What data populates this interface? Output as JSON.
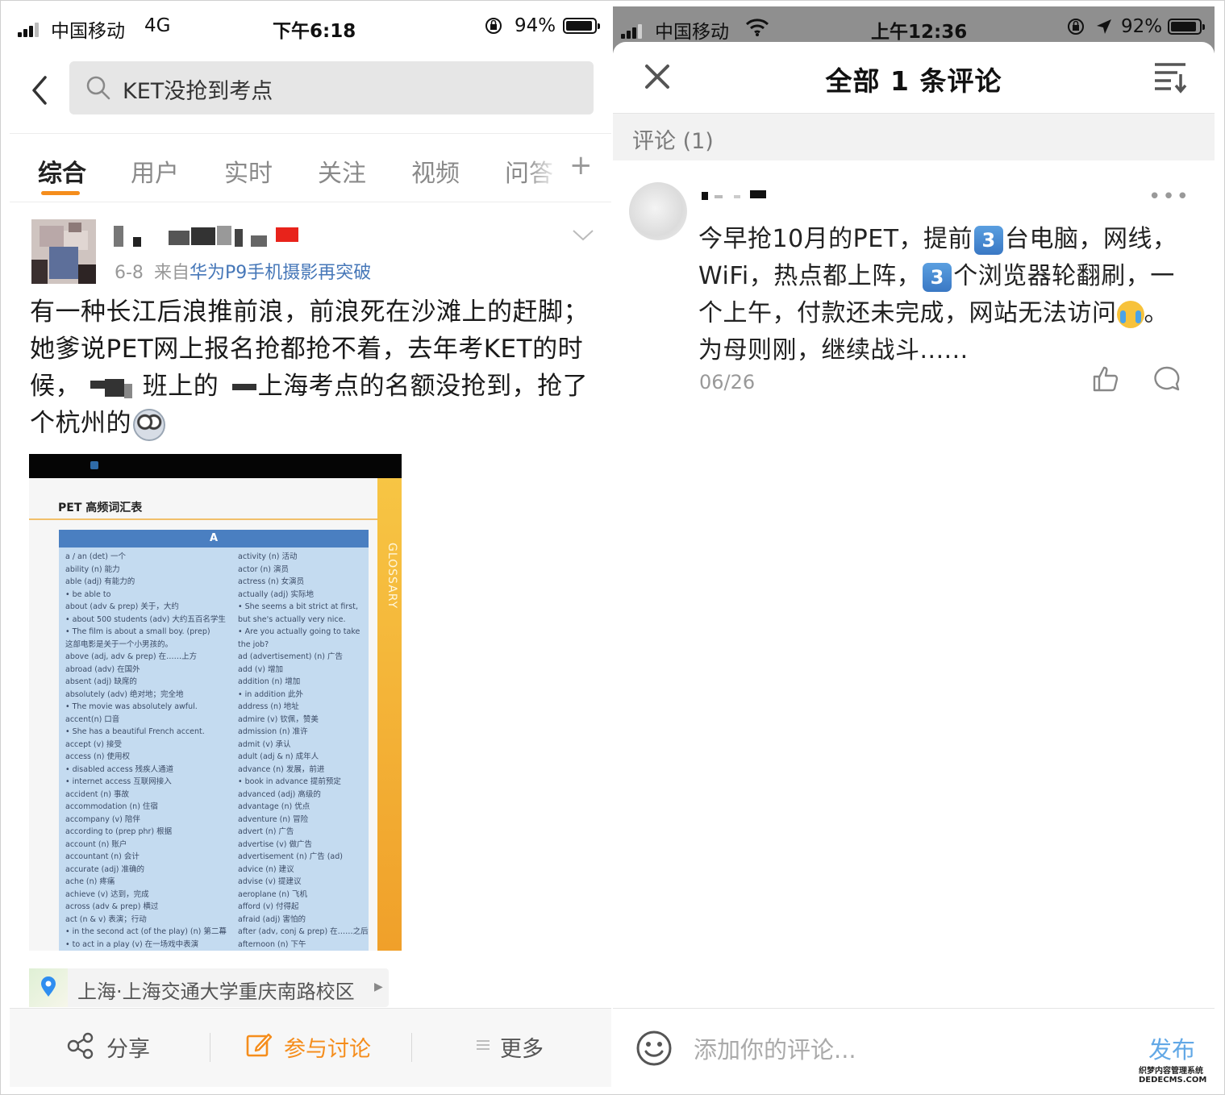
{
  "left": {
    "status": {
      "carrier": "中国移动",
      "network": "4G",
      "time": "下午6:18",
      "battery": "94%",
      "battery_level": 0.94
    },
    "search": {
      "query": "KET没抢到考点"
    },
    "tabs": [
      {
        "label": "综合",
        "active": true
      },
      {
        "label": "用户"
      },
      {
        "label": "实时"
      },
      {
        "label": "关注"
      },
      {
        "label": "视频"
      },
      {
        "label": "问答"
      }
    ],
    "post": {
      "date": "6-8",
      "from_prefix": "来自",
      "source": "华为P9手机摄影再突破",
      "text_part1": "有一种长江后浪推前浪，前浪死在沙滩上的赶脚；她爹说PET网上报名抢都抢不着，去年考KET的时候，",
      "text_part2": "班上的",
      "text_part3": "上海考点的名额没抢到，抢了个杭州的",
      "image": {
        "heading": "PET 高频词汇表",
        "side_label": "GLOSSARY",
        "letter": "A",
        "col1": [
          "a / an (det) 一个",
          "ability (n) 能力",
          "able (adj) 有能力的",
          "• be able to",
          "about (adv & prep) 关于，大约",
          "• about 500 students (adv) 大约五百名学生",
          "• The film is about a small boy. (prep)",
          "   这部电影是关于一个小男孩的。",
          "above (adj, adv & prep) 在……上方",
          "abroad (adv) 在国外",
          "absent (adj) 缺席的",
          "absolutely (adv) 绝对地；完全地",
          "• The movie was absolutely awful.",
          "accent(n) 口音",
          "• She has a beautiful French accent.",
          "accept (v) 接受",
          "access (n) 使用权",
          "• disabled access 残疾人通道",
          "• internet access 互联网接入",
          "accident (n) 事故",
          "accommodation (n) 住宿",
          "accompany (v) 陪伴",
          "according to (prep phr) 根据",
          "account (n) 账户",
          "accountant (n) 会计",
          "accurate (adj) 准确的",
          "ache (n) 疼痛",
          "achieve (v) 达到，完成",
          "across (adv & prep) 横过",
          "act (n & v) 表演；行动",
          "• in the second act (of the play) (n) 第二幕",
          "• to act in a play (v) 在一场戏中表演"
        ],
        "col2": [
          "activity (n) 活动",
          "actor (n) 演员",
          "actress (n) 女演员",
          "actually (adj) 实际地",
          "• She seems a bit strict at first,",
          "   but she's actually very nice.",
          "• Are you actually going to take",
          "   the job?",
          "ad (advertisement) (n) 广告",
          "add (v) 增加",
          "addition (n) 增加",
          "• in addition 此外",
          "address (n) 地址",
          "admire (v) 钦佩，赞美",
          "admission (n) 准许",
          "admit (v) 承认",
          "adult (adj & n) 成年人",
          "advance (n) 发展，前进",
          "• book in advance 提前预定",
          "advanced (adj) 高级的",
          "advantage (n) 优点",
          "adventure (n) 冒险",
          "advert (n) 广告",
          "advertise (v) 做广告",
          "advertisement (n) 广告 (ad)",
          "advice (n) 建议",
          "advise (v) 提建议",
          "aeroplane (n) 飞机",
          "afford (v) 付得起",
          "afraid (adj) 害怕的",
          "after (adv, conj & prep) 在……之后",
          "afternoon (n) 下午"
        ]
      },
      "location": "上海·上海交通大学重庆南路校区"
    },
    "actions": {
      "share": "分享",
      "discuss": "参与讨论",
      "more": "更多"
    }
  },
  "right": {
    "status": {
      "carrier": "中国移动",
      "time": "上午12:36",
      "battery": "92%",
      "battery_level": 0.92
    },
    "title": "全部 1 条评论",
    "section_label": "评论 (1)",
    "comment": {
      "p1": "今早抢10月的PET，提前",
      "badge": "3",
      "p2": "台电脑，网线，WiFi，热点都上阵，",
      "p3": "个浏览器轮翻刷，一个上午，付款还未完成，网站无法访问",
      "p4": "。为母则刚，继续战斗......",
      "date": "06/26",
      "more": "•••"
    },
    "input_placeholder": "添加你的评论...",
    "publish": "发布"
  },
  "watermark": {
    "line1": "织梦内容管理系统",
    "line2": "DEDECMS.COM"
  }
}
